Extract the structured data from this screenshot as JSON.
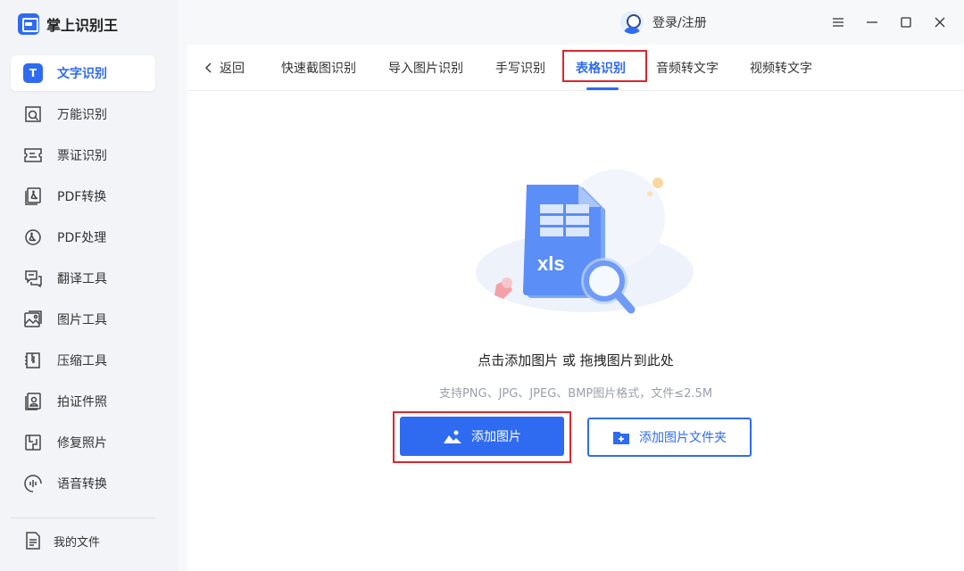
{
  "app": {
    "name": "掌上识别王"
  },
  "sidebar": {
    "active_badge": "T",
    "items": [
      {
        "label": "文字识别",
        "icon": "text-recognition-icon"
      },
      {
        "label": "万能识别",
        "icon": "universal-scan-icon"
      },
      {
        "label": "票证识别",
        "icon": "ticket-icon"
      },
      {
        "label": "PDF转换",
        "icon": "pdf-convert-icon"
      },
      {
        "label": "PDF处理",
        "icon": "pdf-process-icon"
      },
      {
        "label": "翻译工具",
        "icon": "translate-icon"
      },
      {
        "label": "图片工具",
        "icon": "image-tool-icon"
      },
      {
        "label": "压缩工具",
        "icon": "compress-icon"
      },
      {
        "label": "拍证件照",
        "icon": "id-photo-icon"
      },
      {
        "label": "修复照片",
        "icon": "photo-repair-icon"
      },
      {
        "label": "语音转换",
        "icon": "voice-convert-icon"
      }
    ],
    "my_files": "我的文件"
  },
  "titlebar": {
    "login_label": "登录/注册"
  },
  "tabs": {
    "back_label": "返回",
    "items": [
      {
        "label": "快速截图识别"
      },
      {
        "label": "导入图片识别"
      },
      {
        "label": "手写识别"
      },
      {
        "label": "表格识别"
      },
      {
        "label": "音频转文字"
      },
      {
        "label": "视频转文字"
      }
    ],
    "active": "表格识别"
  },
  "upload": {
    "illustration_text": "xls",
    "hint": "点击添加图片 或 拖拽图片到此处",
    "formats": "支持PNG、JPG、JPEG、BMP图片格式，文件≤2.5M",
    "add_image": "添加图片",
    "add_folder": "添加图片文件夹"
  },
  "colors": {
    "accent": "#2f6bf0",
    "highlight_box": "#d9272e"
  }
}
